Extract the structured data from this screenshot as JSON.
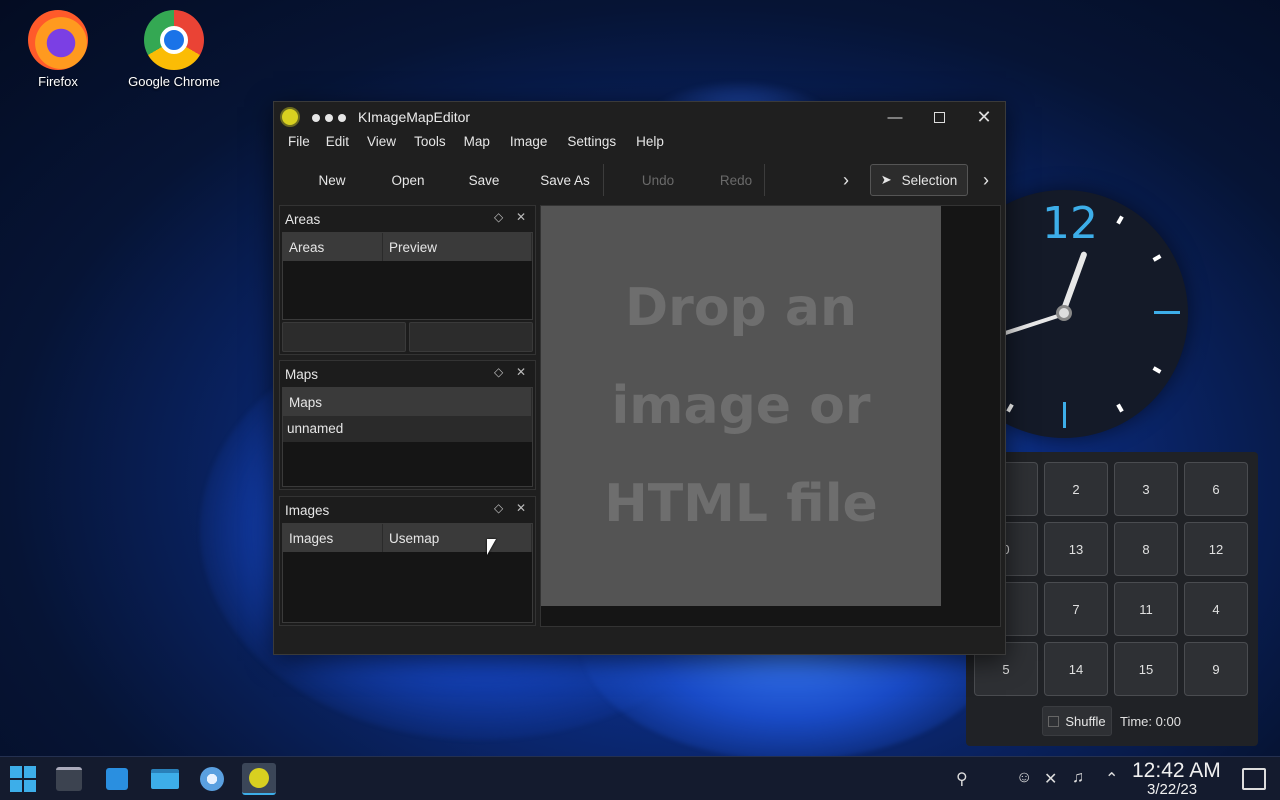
{
  "desktop": {
    "icons": [
      {
        "label": "Firefox"
      },
      {
        "label": "Google Chrome"
      }
    ]
  },
  "clock_widget": {
    "twelve": "12"
  },
  "puzzle": {
    "tiles": [
      "",
      "2",
      "3",
      "6",
      "0",
      "13",
      "8",
      "12",
      "",
      "7",
      "11",
      "4",
      "5",
      "14",
      "15",
      "9"
    ],
    "shuffle_label": "Shuffle",
    "time_label": "Time: 0:00"
  },
  "window": {
    "title": "KImageMapEditor",
    "menu": [
      "File",
      "Edit",
      "View",
      "Tools",
      "Map",
      "Image",
      "Settings",
      "Help"
    ],
    "toolbar": {
      "new": "New",
      "open": "Open",
      "save": "Save",
      "save_as": "Save As",
      "undo": "Undo",
      "redo": "Redo",
      "selection": "Selection"
    },
    "areas_panel": {
      "title": "Areas",
      "columns": [
        "Areas",
        "Preview"
      ]
    },
    "maps_panel": {
      "title": "Maps",
      "columns": [
        "Maps"
      ],
      "rows": [
        "unnamed"
      ]
    },
    "images_panel": {
      "title": "Images",
      "columns": [
        "Images",
        "Usemap"
      ]
    },
    "drop_message": [
      "Drop an",
      "image or",
      "HTML file"
    ]
  },
  "taskbar": {
    "time": "12:42 AM",
    "date": "3/22/23"
  },
  "colors": {
    "accent": "#3daee9",
    "window_bg": "#1f1f1f",
    "drop_bg": "#545454"
  }
}
